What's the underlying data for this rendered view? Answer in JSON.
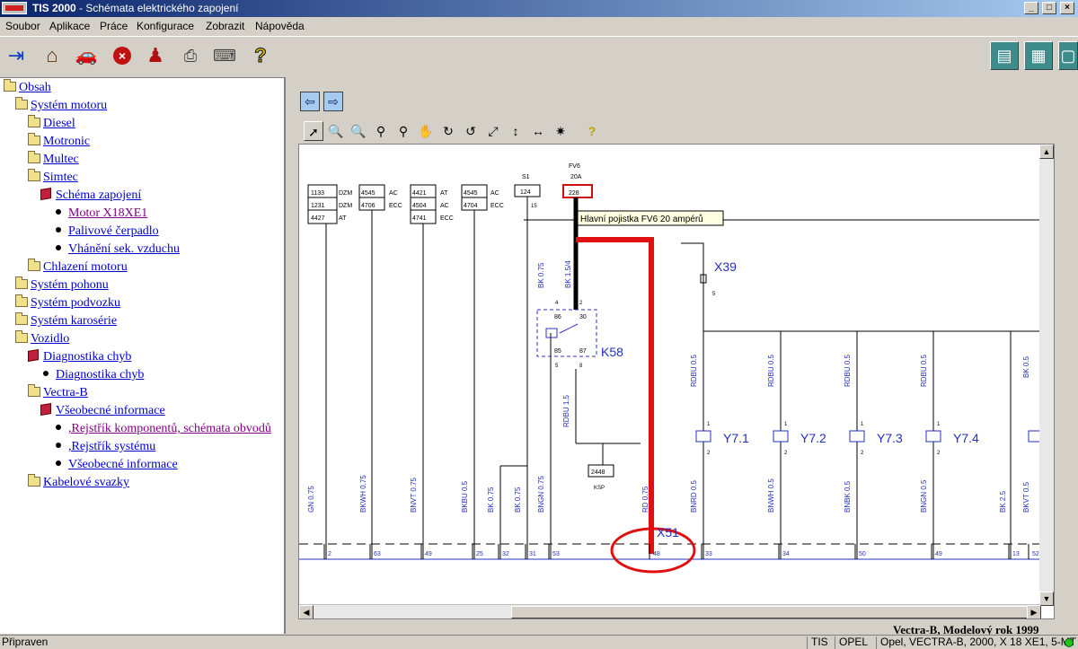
{
  "window": {
    "app_name": "TIS 2000",
    "title_rest": " - Schémata elektrického zapojení",
    "minimize": "_",
    "maximize": "□",
    "close": "×"
  },
  "menu": [
    "Soubor",
    "Aplikace",
    "Práce",
    "Konfigurace",
    "Zobrazit",
    "Nápověda"
  ],
  "toolbar": {
    "left_icons": [
      "exit-icon",
      "home-icon",
      "vehicle-icon",
      "stop-icon",
      "user-icon",
      "print-icon",
      "keyboard-icon",
      "help-icon"
    ],
    "right_icons": [
      "diagnostics-icon",
      "vehicle-info-icon",
      "window-icon"
    ]
  },
  "tree": {
    "items": [
      {
        "label": "Obsah",
        "icon": "folder-icon"
      },
      {
        "label": "Systém motoru",
        "icon": "folder-icon"
      },
      {
        "label": "Diesel",
        "icon": "folder-icon"
      },
      {
        "label": "Motronic",
        "icon": "folder-icon"
      },
      {
        "label": "Multec",
        "icon": "folder-icon"
      },
      {
        "label": "Simtec",
        "icon": "folder-icon"
      },
      {
        "label": "Schéma zapojení",
        "icon": "book-icon"
      },
      {
        "label": "Motor X18XE1",
        "icon": "bullet-icon",
        "visited": true
      },
      {
        "label": "Palivové čerpadlo",
        "icon": "bullet-icon"
      },
      {
        "label": "Vhánění sek. vzduchu",
        "icon": "bullet-icon"
      },
      {
        "label": "Chlazení motoru",
        "icon": "folder-icon"
      },
      {
        "label": "Systém pohonu",
        "icon": "folder-icon"
      },
      {
        "label": "Systém podvozku",
        "icon": "folder-icon"
      },
      {
        "label": "Systém karosérie",
        "icon": "folder-icon"
      },
      {
        "label": "Vozidlo",
        "icon": "folder-icon"
      },
      {
        "label": "Diagnostika chyb",
        "icon": "book-icon"
      },
      {
        "label": "Diagnostika chyb",
        "icon": "bullet-icon"
      },
      {
        "label": "Vectra-B",
        "icon": "folder-icon"
      },
      {
        "label": "Všeobecné informace",
        "icon": "book-icon"
      },
      {
        "label": ",Rejstřík komponentů, schémata obvodů",
        "icon": "bullet-icon",
        "visited": true
      },
      {
        "label": ",Rejstřík systému",
        "icon": "bullet-icon"
      },
      {
        "label": "Všeobecné informace",
        "icon": "bullet-icon"
      },
      {
        "label": "Kabelové svazky",
        "icon": "folder-icon"
      }
    ]
  },
  "viewer": {
    "back_label": "⇦",
    "forward_label": "⇨",
    "tools": [
      "select-arrow-icon",
      "zoom-in-icon",
      "zoom-out-icon",
      "zoom-icon",
      "zoom-window-icon",
      "pan-hand-icon",
      "rotate-right-icon",
      "rotate-left-icon",
      "fit-all-icon",
      "fit-height-icon",
      "fit-width-icon",
      "highlight-icon",
      "help-icon"
    ]
  },
  "diagram": {
    "tooltip": "Hlavní pojistka FV6 20 ampérů",
    "fuse": {
      "name": "FV6",
      "rating": "20A",
      "number": "228"
    },
    "s1": {
      "name": "S1",
      "value": "124",
      "pin": "15"
    },
    "code_boxes": [
      {
        "rows": [
          [
            "1133",
            "DZM"
          ],
          [
            "1231",
            "DZM"
          ],
          [
            "4427",
            "AT"
          ]
        ]
      },
      {
        "rows": [
          [
            "4545",
            "AC"
          ],
          [
            "4706",
            "ECC"
          ]
        ]
      },
      {
        "rows": [
          [
            "4421",
            "AT"
          ],
          [
            "4504",
            "AC"
          ],
          [
            "4741",
            "ECC"
          ]
        ]
      },
      {
        "rows": [
          [
            "4545",
            "AC"
          ],
          [
            "4704",
            "ECC"
          ]
        ]
      }
    ],
    "relay": {
      "name": "K58",
      "pins": [
        "4",
        "2",
        "86",
        "30",
        "85",
        "87",
        "5",
        "8"
      ]
    },
    "connectors": {
      "x39": "X39",
      "x39_pin": "5",
      "x51": "X51",
      "ksp": "KSP",
      "ksp_code": "2448"
    },
    "injectors": [
      "Y7.1",
      "Y7.2",
      "Y7.3",
      "Y7.4"
    ],
    "injector_pins": [
      "1",
      "2"
    ],
    "wire_labels": [
      "GN 0.75",
      "BKWH 0.75",
      "BNVT 0.75",
      "BKBU 0.5",
      "BK 0.75",
      "BK 0.75",
      "BNGN 0.75",
      "BK 0.75",
      "BK 1.5/4",
      "RDBU 1.5",
      "RD 0.75",
      "BNRD 0.5",
      "BNWH 0.5",
      "BNBK 0.5",
      "BNGN 0.5",
      "RDBU 0.5",
      "RDBU 0.5",
      "RDBU 0.5",
      "RDBU 0.5",
      "BK 0.5",
      "BK 2.5",
      "BKVT 0.5"
    ],
    "bottom_pins": [
      "2",
      "63",
      "49",
      "25",
      "32",
      "31",
      "53",
      "48",
      "33",
      "34",
      "50",
      "49",
      "13",
      "52"
    ]
  },
  "caption_peek": "Vectra-B, Modelový rok 1999",
  "status": {
    "ready": "Připraven",
    "system": "TIS",
    "make": "OPEL",
    "vehicle": "Opel, VECTRA-B, 2000, X 18 XE1, 5-MT"
  }
}
